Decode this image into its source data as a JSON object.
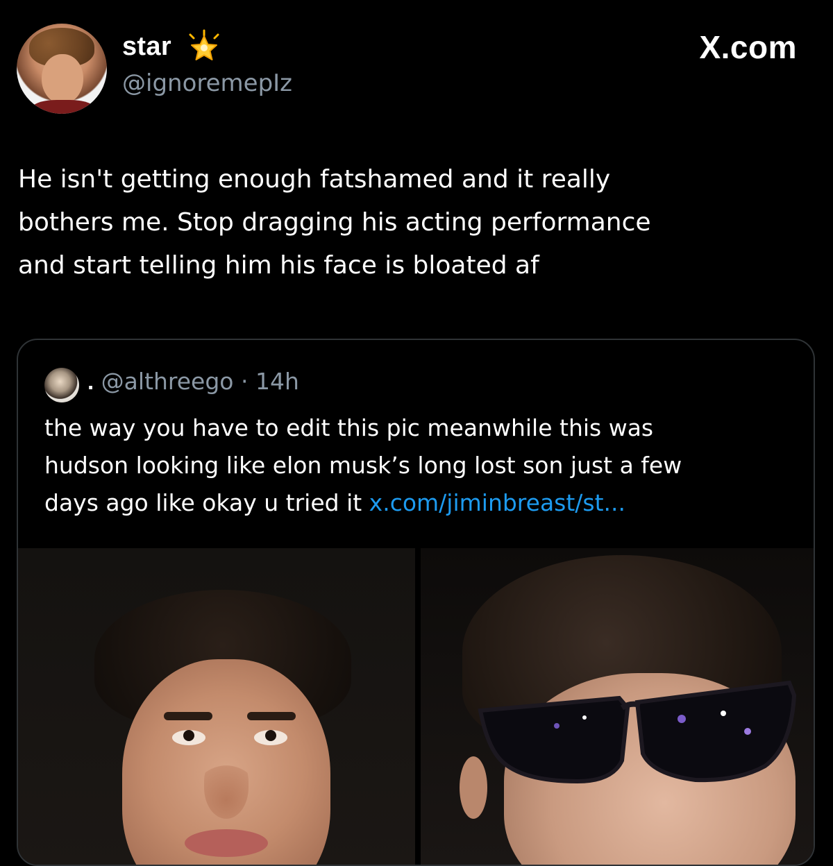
{
  "tweet": {
    "display_name": "star",
    "badge_icon": "sparkle-star-emoji",
    "handle": "@ignoremepIz",
    "brand": "X.com",
    "text_lines": [
      "He isn't getting enough fatshamed and it really",
      "bothers me. Stop dragging his acting performance",
      "and start telling him his face is bloated af"
    ]
  },
  "quote": {
    "display_name": ".",
    "handle": "@althreego",
    "separator": "·",
    "time": "14h",
    "text_lines": [
      "the way you have to edit this pic meanwhile this was",
      "hudson looking like elon musk’s long lost son just a few"
    ],
    "last_line_text": "days ago like okay u tried it ",
    "link_text": "x.com/jiminbreast/st...",
    "media_count": 2
  },
  "colors": {
    "background": "#000000",
    "text_primary": "#ffffff",
    "text_secondary": "#8b98a5",
    "link": "#1d9bf0",
    "card_border": "#2f3336"
  }
}
